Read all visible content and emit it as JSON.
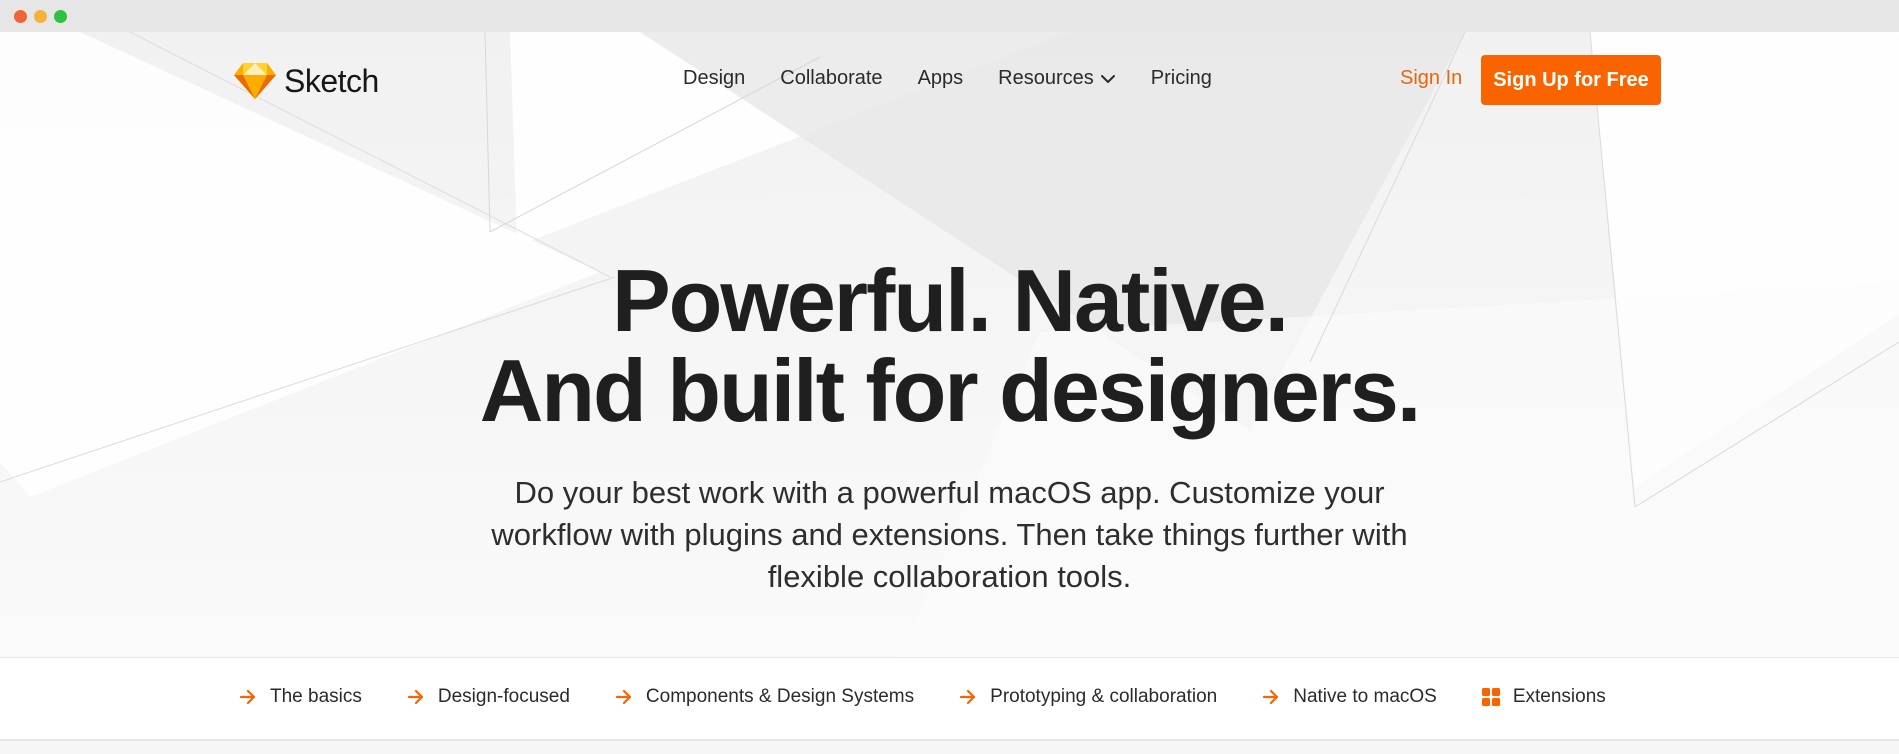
{
  "window": {
    "controls": [
      "close",
      "minimize",
      "maximize"
    ]
  },
  "brand": {
    "name": "Sketch",
    "logo_icon": "sketch-diamond-icon",
    "accent_color": "#fa6400"
  },
  "nav": {
    "items": [
      {
        "label": "Design"
      },
      {
        "label": "Collaborate"
      },
      {
        "label": "Apps"
      },
      {
        "label": "Resources",
        "icon": "chevron-down-icon"
      },
      {
        "label": "Pricing"
      }
    ],
    "sign_in": "Sign In",
    "sign_up": "Sign Up for Free"
  },
  "hero": {
    "title_line1": "Powerful. Native.",
    "title_line2": "And built for designers.",
    "subtitle": "Do your best work with a powerful macOS app. Customize your workflow with plugins and extensions. Then take things further with flexible collaboration tools."
  },
  "feature_tabs": [
    {
      "label": "The basics",
      "icon": "arrow-right-icon"
    },
    {
      "label": "Design-focused",
      "icon": "arrow-right-icon"
    },
    {
      "label": "Components & Design Systems",
      "icon": "arrow-right-icon"
    },
    {
      "label": "Prototyping & collaboration",
      "icon": "arrow-right-icon"
    },
    {
      "label": "Native to macOS",
      "icon": "arrow-right-icon"
    },
    {
      "label": "Extensions",
      "icon": "grid-icon"
    }
  ]
}
